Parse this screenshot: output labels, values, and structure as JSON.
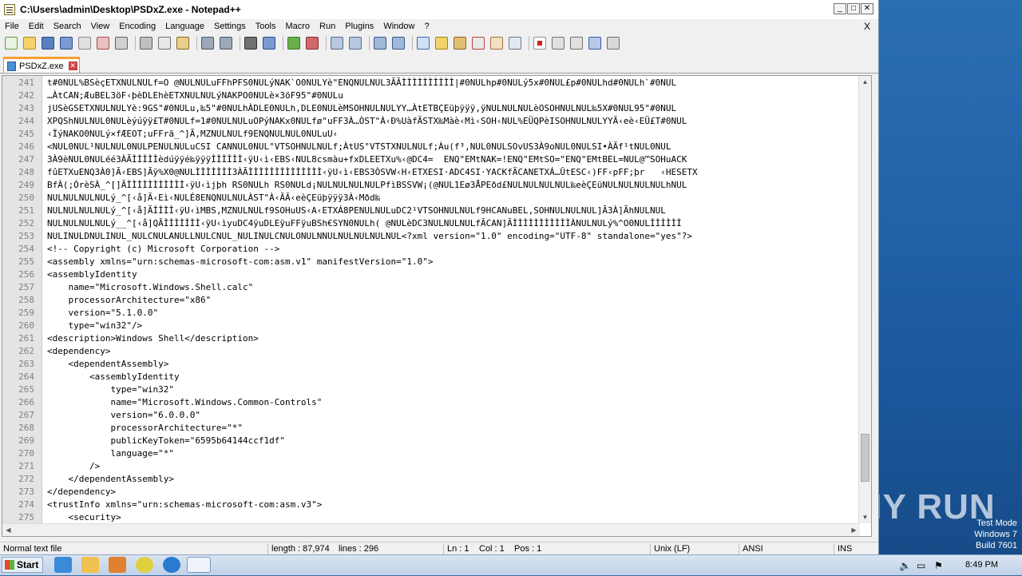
{
  "window": {
    "title": "C:\\Users\\admin\\Desktop\\PSDxZ.exe - Notepad++"
  },
  "menubar": {
    "items": [
      "File",
      "Edit",
      "Search",
      "View",
      "Encoding",
      "Language",
      "Settings",
      "Tools",
      "Macro",
      "Run",
      "Plugins",
      "Window",
      "?"
    ],
    "close": "X"
  },
  "tab": {
    "label": "PSDxZ.exe"
  },
  "editor": {
    "lines": [
      {
        "n": "241",
        "t": "t#0NUL%BSèçETXNULNULf=O @NULNULuFFhPFS0NULýNAK`O0NULYè\"ENQNULNUL3ÃÃÌÌÌÌÌÌÌÌÌÌ|#0NULhp#0NULý5x#0NUL£p#0NULhd#0NULh`#0NUL"
      },
      {
        "n": "242",
        "t": "…ÀtCAN;ÆuBEL3öF‹þèDLEhèETXNULNULýNAKPO0NULè×3öF95\"#0NULu"
      },
      {
        "n": "243",
        "t": "jUSèGSETXNULNULYè:9GS\"#0NULu,‰5\"#0NULhÀDLE0NULh,DLE0NULèMSOHNULNULYY…ÀtETBÇEüþÿÿÿ,ÿNULNULNULèOSOHNULNUL‰5X#0NUL95\"#0NUL"
      },
      {
        "n": "244",
        "t": "XPQShNULNUL0NULèýúÿÿ£T#0NULf=1#0NULNULuOPýNAKx0NULfø\"uFF3À…ÒST\"À‹Ð%UàfÃSTX‰Màè‹Mì‹SOH‹NUL%EÜQPèISOHNULNULYYÃ‹eè‹EÜ£T#0NUL"
      },
      {
        "n": "245",
        "t": "‹ÏýNAKO0NULý×fÆEOT;uFFrä_^]Ã,MZNULNULf9ENQNULNUL0NULuU‹"
      },
      {
        "n": "246",
        "t": "<NUL0NUL¹NULNUL0NULPENULNULuCSI CANNUL0NUL°VTSOHNULNULf;ÀtUS°VTSTXNULNULf;Àu(f³,NUL0NULSOvUS3À9oNUL0NULSI•ÀÃf¹tNUL0NUL"
      },
      {
        "n": "247",
        "t": "3À9èNUL0NULéé3ÀÃÌÌÌÌÌèdúÿÿé‰ÿÿÿÌÌÌÌÌÌ‹ÿU‹ì‹EBS‹NUL8csmàu+fxDLEETXu%‹@DC4=  ENQ\"EMtNAK=!ENQ\"EMtSO=\"ENQ\"EMtBEL=NUL@™SOHuACK"
      },
      {
        "n": "248",
        "t": "fûETXuENQ3À0]Ã‹EBS]Ãÿ%X0@NULÌÌÌÌÌÌÌ3ÀÃÌÌÌÌÌÌÌÌÌÌÌÌÌÌ‹ÿU‹ì‹EBS3ÒSVW‹H‹ETXESI·ADC4SI·YACKfÃCANETXÁ…ÛtESC‹)FF‹pFF;þr   ‹HESETX"
      },
      {
        "n": "249",
        "t": "BfÀ(;ÓrèSÀ_^[]ÃÌÌÌÌÌÌÌÌÌÌÌ‹ÿU‹ìjþh RS0NULh RS0NULd¡NULNULNULNULPfìBSSVW¡(@NUL1Eø3ÅPEðd£NULNULNULNUL‰eèÇEüNULNULNULNULhNUL"
      },
      {
        "n": "250",
        "t": "NULNULNULNULý_^[‹å]Ã‹Eì‹NULÉ8ENQNULNULÀST\"À‹ÃÃ‹eèÇEüþÿÿÿ3À‹Mðd‰"
      },
      {
        "n": "251",
        "t": "NULNULNULNULý_^[‹å]ÃÌÌÌÌ‹ÿU‹ìMBS,MZNULNULf9SOHuUS‹A‹ETXÁ8PENULNULuDC2¹VTSOHNULNULf9HCANuBEL,SOHNULNULNUL]Ã3À]ÃhNULNUL"
      },
      {
        "n": "252",
        "t": "NULNULNULNULý__^[‹å]QÃÌÌÌÌÌÌÌ‹ÿU‹ìyuDC4ÿuDLEÿuFFÿuBSh€SYN0NULh( @NULèDC3NULNULNULfÃCAN]ÃÌÌÌÌÌÌÌÌÌÌÌÀNULNULý%^O0NULÌÌÌÌÌÌ"
      },
      {
        "n": "253",
        "t": "NULINULDNULINUL_NULCNULANULLNULCNUL_NULINULCNULONULNNULNULNULNULNUL<?xml version=\"1.0\" encoding=\"UTF-8\" standalone=\"yes\"?>"
      },
      {
        "n": "254",
        "t": "<!-- Copyright (c) Microsoft Corporation -->"
      },
      {
        "n": "255",
        "t": "<assembly xmlns=\"urn:schemas-microsoft-com:asm.v1\" manifestVersion=\"1.0\">"
      },
      {
        "n": "256",
        "t": "<assemblyIdentity"
      },
      {
        "n": "257",
        "t": "    name=\"Microsoft.Windows.Shell.calc\""
      },
      {
        "n": "258",
        "t": "    processorArchitecture=\"x86\""
      },
      {
        "n": "259",
        "t": "    version=\"5.1.0.0\""
      },
      {
        "n": "260",
        "t": "    type=\"win32\"/>"
      },
      {
        "n": "261",
        "t": "<description>Windows Shell</description>"
      },
      {
        "n": "262",
        "t": "<dependency>"
      },
      {
        "n": "263",
        "t": "    <dependentAssembly>"
      },
      {
        "n": "264",
        "t": "        <assemblyIdentity"
      },
      {
        "n": "265",
        "t": "            type=\"win32\""
      },
      {
        "n": "266",
        "t": "            name=\"Microsoft.Windows.Common-Controls\""
      },
      {
        "n": "267",
        "t": "            version=\"6.0.0.0\""
      },
      {
        "n": "268",
        "t": "            processorArchitecture=\"*\""
      },
      {
        "n": "269",
        "t": "            publicKeyToken=\"6595b64144ccf1df\""
      },
      {
        "n": "270",
        "t": "            language=\"*\""
      },
      {
        "n": "271",
        "t": "        />"
      },
      {
        "n": "272",
        "t": "    </dependentAssembly>"
      },
      {
        "n": "273",
        "t": "</dependency>"
      },
      {
        "n": "274",
        "t": "<trustInfo xmlns=\"urn:schemas-microsoft-com:asm.v3\">"
      },
      {
        "n": "275",
        "t": "    <security>"
      }
    ]
  },
  "status": {
    "file_type": "Normal text file",
    "length": "length : 87,974",
    "lines": "lines : 296",
    "ln": "Ln : 1",
    "col": "Col : 1",
    "pos": "Pos : 1",
    "eol": "Unix (LF)",
    "encoding": "ANSI",
    "mode": "INS"
  },
  "taskbar": {
    "start_label": "Start",
    "clock": "8:49 PM"
  },
  "desktop": {
    "watermark": "ANY RUN",
    "test_mode": "Test Mode",
    "os_name": "Windows 7",
    "build": "Build 7601"
  }
}
